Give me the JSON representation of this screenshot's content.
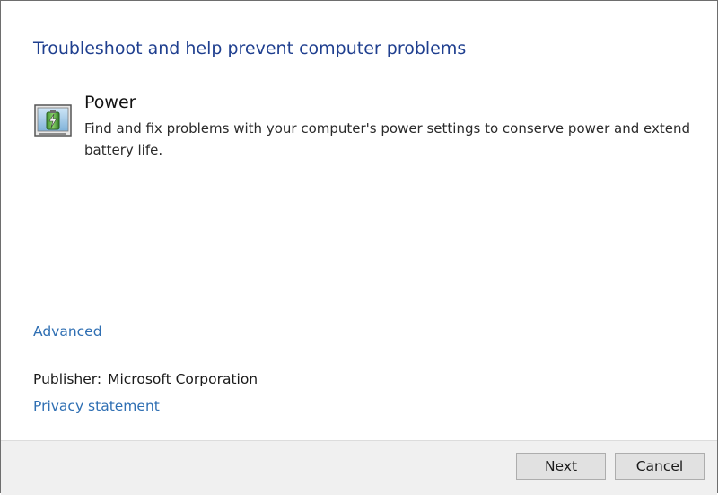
{
  "wizard": {
    "heading": "Troubleshoot and help prevent computer problems",
    "item": {
      "icon": "power-troubleshooter-icon",
      "title": "Power",
      "description": "Find and fix problems with your computer's power settings to conserve power and extend battery life."
    },
    "advanced_label": "Advanced",
    "publisher_label": "Publisher:",
    "publisher_value": "Microsoft Corporation",
    "privacy_label": "Privacy statement"
  },
  "footer": {
    "next_label": "Next",
    "cancel_label": "Cancel"
  },
  "colors": {
    "heading": "#1f3f8f",
    "link": "#2f6fb3",
    "footer_bg": "#f0f0f0",
    "button_bg": "#e1e1e1"
  }
}
